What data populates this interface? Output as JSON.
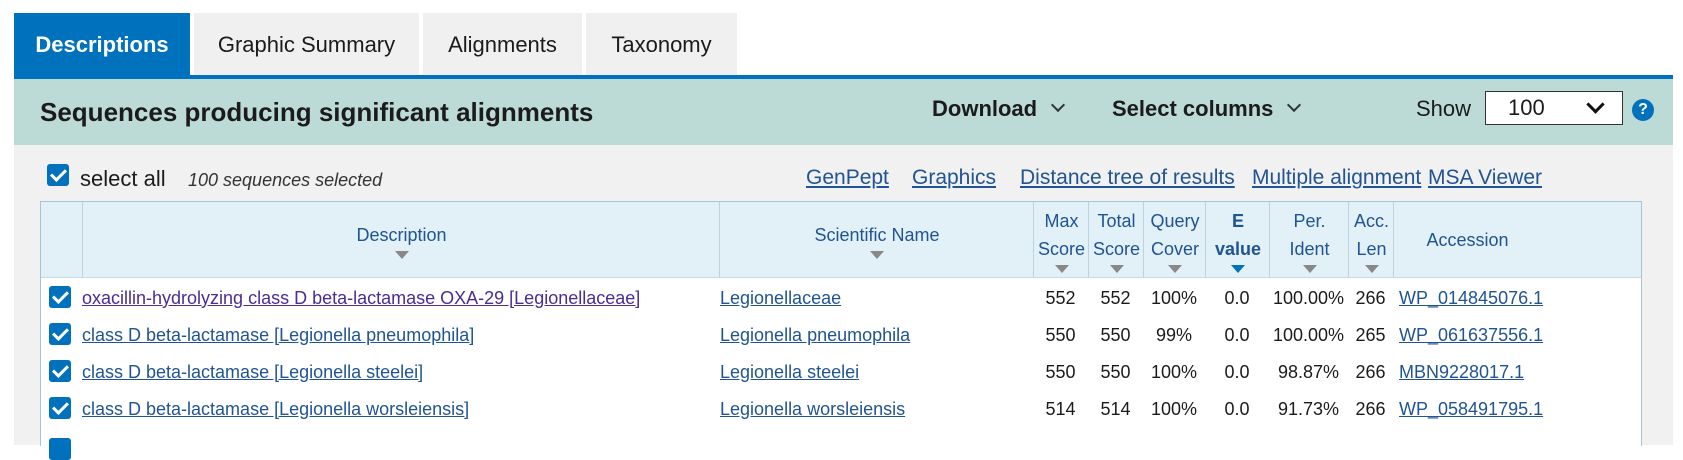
{
  "tabs": [
    {
      "label": "Descriptions"
    },
    {
      "label": "Graphic Summary"
    },
    {
      "label": "Alignments"
    },
    {
      "label": "Taxonomy"
    }
  ],
  "header": {
    "title": "Sequences producing significant alignments",
    "download_label": "Download",
    "select_columns_label": "Select columns",
    "show_label": "Show",
    "show_value": "100",
    "help_icon": "?"
  },
  "toolbar": {
    "select_all_label": "select all",
    "selected_count": "100 sequences selected",
    "links": [
      "GenPept",
      "Graphics",
      "Distance tree of results",
      "Multiple alignment",
      "MSA Viewer"
    ]
  },
  "table": {
    "columns": {
      "description": "Description",
      "scientific_name": "Scientific Name",
      "max_score_1": "Max",
      "max_score_2": "Score",
      "total_score_1": "Total",
      "total_score_2": "Score",
      "query_cover_1": "Query",
      "query_cover_2": "Cover",
      "evalue_1": "E",
      "evalue_2": "value",
      "per_ident_1": "Per.",
      "per_ident_2": "Ident",
      "acc_len_1": "Acc.",
      "acc_len_2": "Len",
      "accession": "Accession"
    },
    "rows": [
      {
        "description": "oxacillin-hydrolyzing class D beta-lactamase OXA-29 [Legionellaceae]",
        "scientific_name": "Legionellaceae",
        "max_score": "552",
        "total_score": "552",
        "query_cover": "100%",
        "evalue": "0.0",
        "per_ident": "100.00%",
        "acc_len": "266",
        "accession": "WP_014845076.1"
      },
      {
        "description": "class D beta-lactamase [Legionella pneumophila]",
        "scientific_name": "Legionella pneumophila",
        "max_score": "550",
        "total_score": "550",
        "query_cover": "99%",
        "evalue": "0.0",
        "per_ident": "100.00%",
        "acc_len": "265",
        "accession": "WP_061637556.1"
      },
      {
        "description": "class D beta-lactamase [Legionella steelei]",
        "scientific_name": "Legionella steelei",
        "max_score": "550",
        "total_score": "550",
        "query_cover": "100%",
        "evalue": "0.0",
        "per_ident": "98.87%",
        "acc_len": "266",
        "accession": "MBN9228017.1"
      },
      {
        "description": "class D beta-lactamase [Legionella worsleiensis]",
        "scientific_name": "Legionella worsleiensis",
        "max_score": "514",
        "total_score": "514",
        "query_cover": "100%",
        "evalue": "0.0",
        "per_ident": "91.73%",
        "acc_len": "266",
        "accession": "WP_058491795.1"
      }
    ]
  },
  "colors": {
    "accent": "#0071bc",
    "header_band": "#bcdbd6",
    "link": "#205493",
    "visited_link": "#4c2c92"
  }
}
